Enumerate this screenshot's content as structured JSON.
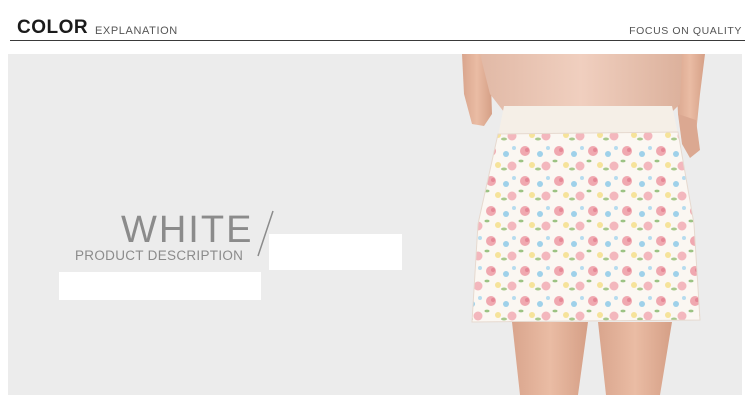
{
  "header": {
    "title": "COLOR",
    "subtitle": "EXPLANATION",
    "tagline": "FOCUS ON QUALITY"
  },
  "panel": {
    "color_name": "WHITE",
    "description_label": "PRODUCT DESCRIPTION"
  },
  "colors": {
    "panel_background": "#ececec",
    "heading_text": "#8b8b8b",
    "rule": "#3a3a3a"
  }
}
